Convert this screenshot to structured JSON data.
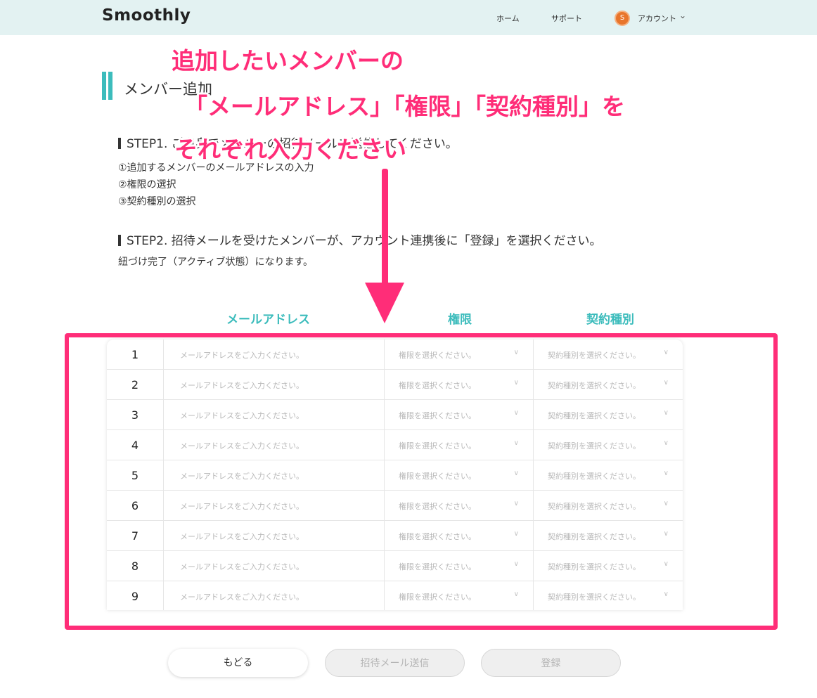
{
  "header": {
    "logo": "Smoothly",
    "nav": {
      "home": "ホーム",
      "support": "サポート",
      "account": "アカウント",
      "avatar_initial": "S"
    }
  },
  "page": {
    "title": "メンバー追加",
    "step1": {
      "heading": "STEP1. ご自身でメンバーの招待メールを送信してください。",
      "items": [
        "①追加するメンバーのメールアドレスの入力",
        "②権限の選択",
        "③契約種別の選択"
      ]
    },
    "step2": {
      "heading": "STEP2. 招待メールを受けたメンバーが、アカウント連携後に「登録」を選択ください。",
      "note": "紐づけ完了（アクティブ状態）になります。"
    }
  },
  "annotation": {
    "line1": "追加したいメンバーの",
    "line2": "「メールアドレス」「権限」「契約種別」を",
    "line3": "それぞれ入力ください",
    "color": "#ff2d78"
  },
  "table": {
    "headers": {
      "email": "メールアドレス",
      "permission": "権限",
      "contract": "契約種別"
    },
    "email_placeholder": "メールアドレスをご入力ください。",
    "permission_placeholder": "権限を選択ください。",
    "contract_placeholder": "契約種別を選択ください。",
    "rows": [
      "1",
      "2",
      "3",
      "4",
      "5",
      "6",
      "7",
      "8",
      "9"
    ]
  },
  "buttons": {
    "back": "もどる",
    "send_invite": "招待メール送信",
    "register": "登録"
  },
  "colors": {
    "accent": "#3cbcbc",
    "header_bg": "#e3f2f2",
    "highlight": "#ff2d78"
  }
}
